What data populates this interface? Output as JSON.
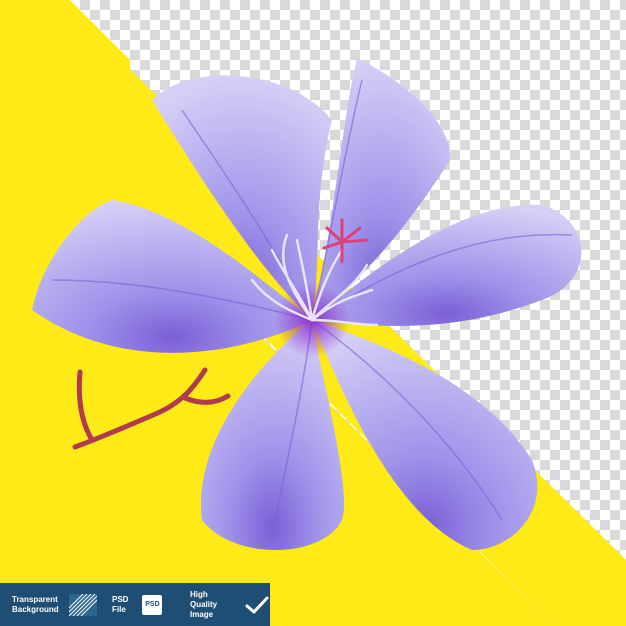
{
  "image": {
    "subject": "purple-flower",
    "colors": {
      "background_yellow": "#fdea16",
      "checker_light": "#ffffff",
      "checker_dark": "#d9d9d9",
      "petal_light": "#c9c2f3",
      "petal_mid": "#9f93ea",
      "petal_deep": "#7b5fd6",
      "center": "#8b2fd0",
      "stamen": "#e8e4f8",
      "pistil": "#e0407a",
      "stem": "#b03a4e",
      "badge_bg": "#1f4e74"
    }
  },
  "badges": [
    {
      "line1": "Transparent",
      "line2": "Background",
      "icon": "transparent-grid-icon"
    },
    {
      "line1": "PSD",
      "line2": "File",
      "icon": "psd-file-icon",
      "icon_text": "PSD"
    },
    {
      "line1": "High Quality",
      "line2": "Image",
      "icon": "checkmark-icon"
    }
  ]
}
